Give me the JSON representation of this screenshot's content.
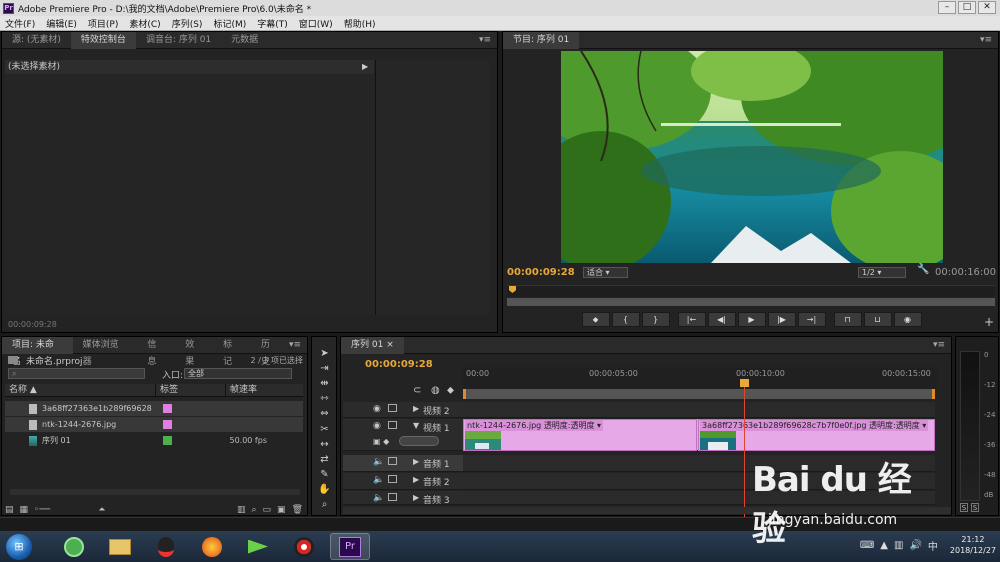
{
  "window": {
    "title": "Adobe Premiere Pro - D:\\我的文档\\Adobe\\Premiere Pro\\6.0\\未命名 *",
    "app_icon": "Pr"
  },
  "menu": [
    "文件(F)",
    "编辑(E)",
    "项目(P)",
    "素材(C)",
    "序列(S)",
    "标记(M)",
    "字幕(T)",
    "窗口(W)",
    "帮助(H)"
  ],
  "source_panel": {
    "tabs": [
      "源: (无素材)",
      "特效控制台",
      "调音台: 序列 01",
      "元数据"
    ],
    "active_tab": 1,
    "header": "(未选择素材)",
    "timecode": "00:00:09:28"
  },
  "program_panel": {
    "tab": "节目: 序列 01",
    "timecode": "00:00:09:28",
    "fit": "适合",
    "ratio": "1/2",
    "duration": "00:00:16:00"
  },
  "project_panel": {
    "tabs": [
      "项目: 未命名",
      "媒体浏览器",
      "信息",
      "效果",
      "标记",
      "历史"
    ],
    "project_file": "未命名.prproj",
    "selection_count": "2 / 3 项已选择",
    "search_placeholder": "",
    "in_label": "入口:",
    "in_value": "全部",
    "columns": [
      "名称",
      "标签",
      "帧速率"
    ],
    "items": [
      {
        "name": "3a68ff27363e1b289f69628",
        "label_color": "#e27ee2",
        "fps": ""
      },
      {
        "name": "ntk-1244-2676.jpg",
        "label_color": "#e27ee2",
        "fps": ""
      },
      {
        "name": "序列 01",
        "label_color": "#4caf50",
        "fps": "50.00 fps"
      }
    ]
  },
  "timeline": {
    "tab": "序列 01",
    "timecode": "00:00:09:28",
    "ticks": [
      "00:00",
      "00:00:05:00",
      "00:00:10:00",
      "00:00:15:00"
    ],
    "tracks": [
      {
        "name": "视频 2",
        "type": "video"
      },
      {
        "name": "视频 1",
        "type": "video"
      },
      {
        "name": "音频 1",
        "type": "audio"
      },
      {
        "name": "音频 2",
        "type": "audio"
      },
      {
        "name": "音频 3",
        "type": "audio"
      }
    ],
    "clips": [
      {
        "name": "ntk-1244-2676.jpg",
        "effect": "透明度:透明度 ▾"
      },
      {
        "name": "3a68ff27363e1b289f69628c7b7f0e0f.jpg",
        "effect": "透明度:透明度 ▾"
      }
    ]
  },
  "audio_meter": {
    "labels": [
      "0",
      "-12",
      "-24",
      "-36",
      "-48",
      "dB"
    ],
    "buttons": [
      "S",
      "S"
    ]
  },
  "taskbar": {
    "time": "21:12",
    "date": "2018/12/27"
  },
  "watermark": {
    "main": "Bai du 经验",
    "sub": "jingyan.baidu.com"
  }
}
